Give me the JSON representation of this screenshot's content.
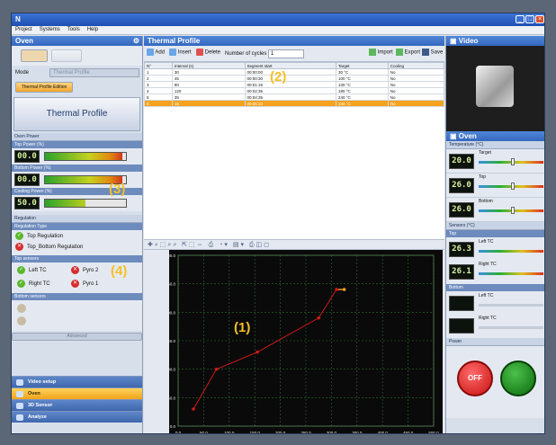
{
  "window": {
    "app_icon": "N",
    "controls": [
      "_",
      "□",
      "×"
    ]
  },
  "menu": [
    "Project",
    "Systems",
    "Tools",
    "Help"
  ],
  "overlays": {
    "chart": "(1)",
    "table": "(2)",
    "power": "(3)",
    "regulation": "(4)"
  },
  "left": {
    "title": "Oven",
    "mode_label": "Mode",
    "mode_value": "Thermal Profile",
    "edition_button": "Thermal Profile Edition",
    "big_label": "Thermal Profile",
    "oven_power_label": "Oven Power",
    "powers": [
      {
        "label": "Top Power (%)",
        "value": "00.0",
        "fill_fraction": 0.95
      },
      {
        "label": "Bottom Power (%)",
        "value": "00.0",
        "fill_fraction": 0.95
      },
      {
        "label": "Cooling Power (%)",
        "value": "50.0",
        "fill_fraction": 0.5
      }
    ],
    "regulation_label": "Regulation",
    "regulation_type_label": "Regulation Type",
    "regulation_options": [
      {
        "label": "Top Regulation",
        "state": "ok"
      },
      {
        "label": "Top_Bottom Regulation",
        "state": "error"
      }
    ],
    "top_sensors_label": "Top sensors",
    "top_sensors": [
      {
        "label": "Left TC",
        "state": "ok"
      },
      {
        "label": "Pyro 2",
        "state": "error"
      },
      {
        "label": "Right TC",
        "state": "ok"
      },
      {
        "label": "Pyro 1",
        "state": "error"
      }
    ],
    "bottom_sensors_label": "Bottom sensors",
    "advanced_button": "Advanced",
    "nav": [
      {
        "label": "Video setup",
        "icon": "camera-icon",
        "active": false
      },
      {
        "label": "Oven",
        "icon": "oven-icon",
        "active": true
      },
      {
        "label": "3D Sensor",
        "icon": "sensor-icon",
        "active": false
      },
      {
        "label": "Analyze",
        "icon": "analyze-icon",
        "active": false
      }
    ]
  },
  "center": {
    "title": "Thermal Profile",
    "toolbar": {
      "add": "Add",
      "insert": "Insert",
      "delete": "Delete",
      "cycles_label": "Number of cycles",
      "cycles_value": "1",
      "import": "Import",
      "export": "Export",
      "save": "Save"
    },
    "table": {
      "columns": [
        "N°",
        "Interval (s)",
        "Segment start",
        "Target",
        "Cooling"
      ],
      "rows": [
        [
          "1",
          "30",
          "00:00:00",
          "30 °C",
          "No"
        ],
        [
          "2",
          "45",
          "00:00:30",
          "100 °C",
          "No"
        ],
        [
          "3",
          "80",
          "00:01:15",
          "130 °C",
          "No"
        ],
        [
          "4",
          "120",
          "00:02:35",
          "190 °C",
          "No"
        ],
        [
          "5",
          "35",
          "00:04:35",
          "240 °C",
          "No"
        ],
        [
          "6",
          "15",
          "00:05:10",
          "240 °C",
          "No"
        ]
      ],
      "selected_row": 5
    }
  },
  "chart_data": {
    "type": "line",
    "x": [
      30,
      75,
      155,
      275,
      310,
      325
    ],
    "y": [
      30,
      100,
      130,
      190,
      240,
      240
    ],
    "xlim": [
      0,
      500
    ],
    "ylim": [
      0,
      300
    ],
    "xticks": [
      "0.0",
      "50.0",
      "100.0",
      "150.0",
      "200.0",
      "250.0",
      "300.0",
      "350.0",
      "400.0",
      "450.0",
      "500.0"
    ],
    "yticks": [
      "0.0",
      "50.0",
      "100.0",
      "150.0",
      "200.0",
      "250.0",
      "300.0"
    ],
    "grid": true,
    "line_color": "#d01818",
    "current_color": "#f0a020"
  },
  "right": {
    "video_title": "Video",
    "oven_title": "Oven",
    "temperature_label": "Temperature (°C)",
    "temps": [
      {
        "label": "Target",
        "value": "20.0"
      },
      {
        "label": "Top",
        "value": "26.0"
      },
      {
        "label": "Bottom",
        "value": "26.0"
      }
    ],
    "sensors_label": "Sensors (°C)",
    "top_label": "Top",
    "top_readings": [
      {
        "label": "Left TC",
        "value": "26.3"
      },
      {
        "label": "Right TC",
        "value": "26.1"
      }
    ],
    "bottom_label": "Bottom",
    "bottom_readings": [
      {
        "label": "Left TC"
      },
      {
        "label": "Right TC"
      }
    ],
    "power_label": "Power",
    "off_button": "OFF"
  }
}
